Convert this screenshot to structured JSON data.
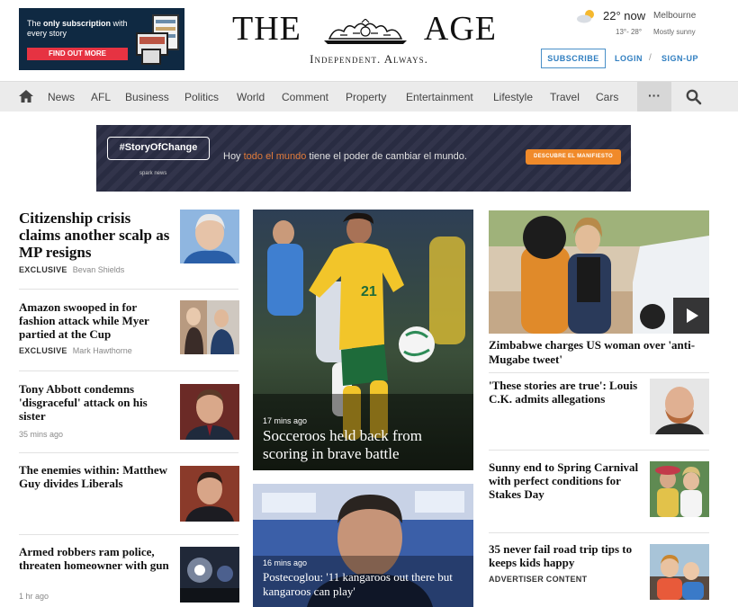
{
  "promo": {
    "text_bold": "only subscription",
    "text_pre": "The ",
    "text_post": " with every story",
    "button": "FIND OUT MORE"
  },
  "masthead": {
    "logo_left": "THE",
    "logo_right": "AGE",
    "tagline": "Independent. Always."
  },
  "weather": {
    "temp": "22° now",
    "city": "Melbourne",
    "range": "13°- 28°",
    "condition": "Mostly sunny",
    "icon": "partly-sunny-icon"
  },
  "account": {
    "subscribe": "SUBSCRIBE",
    "login": "LOGIN",
    "separator": "/",
    "signup": "SIGN-UP"
  },
  "nav": {
    "items": [
      "News",
      "AFL",
      "Business",
      "Politics",
      "World",
      "Comment",
      "Property",
      "Entertainment",
      "Lifestyle",
      "Travel",
      "Cars"
    ],
    "more": "···"
  },
  "ad": {
    "hashtag": "#StoryOfChange",
    "brand": "spark news",
    "msg_pre": "Hoy ",
    "msg_highlight": "todo el mundo",
    "msg_post": " tiene el poder de cambiar el mundo.",
    "cta": "DESCUBRE EL MANIFIESTO"
  },
  "left_stories": [
    {
      "title": "Citizenship crisis claims another scalp as MP resigns",
      "tag": "EXCLUSIVE",
      "meta": "Bevan Shields"
    },
    {
      "title": "Amazon swooped in for fashion attack while Myer partied at the Cup",
      "tag": "EXCLUSIVE",
      "meta": "Mark Hawthorne"
    },
    {
      "title": "Tony Abbott condemns 'disgraceful' attack on his sister",
      "tag": "",
      "meta": "35 mins ago"
    },
    {
      "title": "The enemies within: Matthew Guy divides Liberals",
      "tag": "",
      "meta": ""
    },
    {
      "title": "Armed robbers ram police, threaten homeowner with gun",
      "tag": "",
      "meta": "1 hr ago"
    }
  ],
  "center": {
    "hero": {
      "time": "17 mins ago",
      "title": "Socceroos held back from scoring in brave battle",
      "jersey": "21"
    },
    "second": {
      "time": "16 mins ago",
      "title": "Postecoglou: '11 kangaroos out there but kangaroos can play'"
    }
  },
  "right": {
    "hero_title": "Zimbabwe charges US woman over 'anti-Mugabe tweet'",
    "stories": [
      {
        "title": "'These stories are true': Louis C.K. admits allegations",
        "tag": ""
      },
      {
        "title": "Sunny end to Spring Carnival with perfect conditions for Stakes Day",
        "tag": ""
      },
      {
        "title": "35 never fail road trip tips to keeps kids happy",
        "tag": "ADVERTISER CONTENT"
      }
    ]
  },
  "colors": {
    "promo_bg": "#0f2942",
    "promo_button": "#e63342",
    "link_blue": "#2f7ec0",
    "nav_bg": "#ebebeb",
    "ad_bg": "#2b2e45",
    "ad_cta": "#f08a2a"
  }
}
